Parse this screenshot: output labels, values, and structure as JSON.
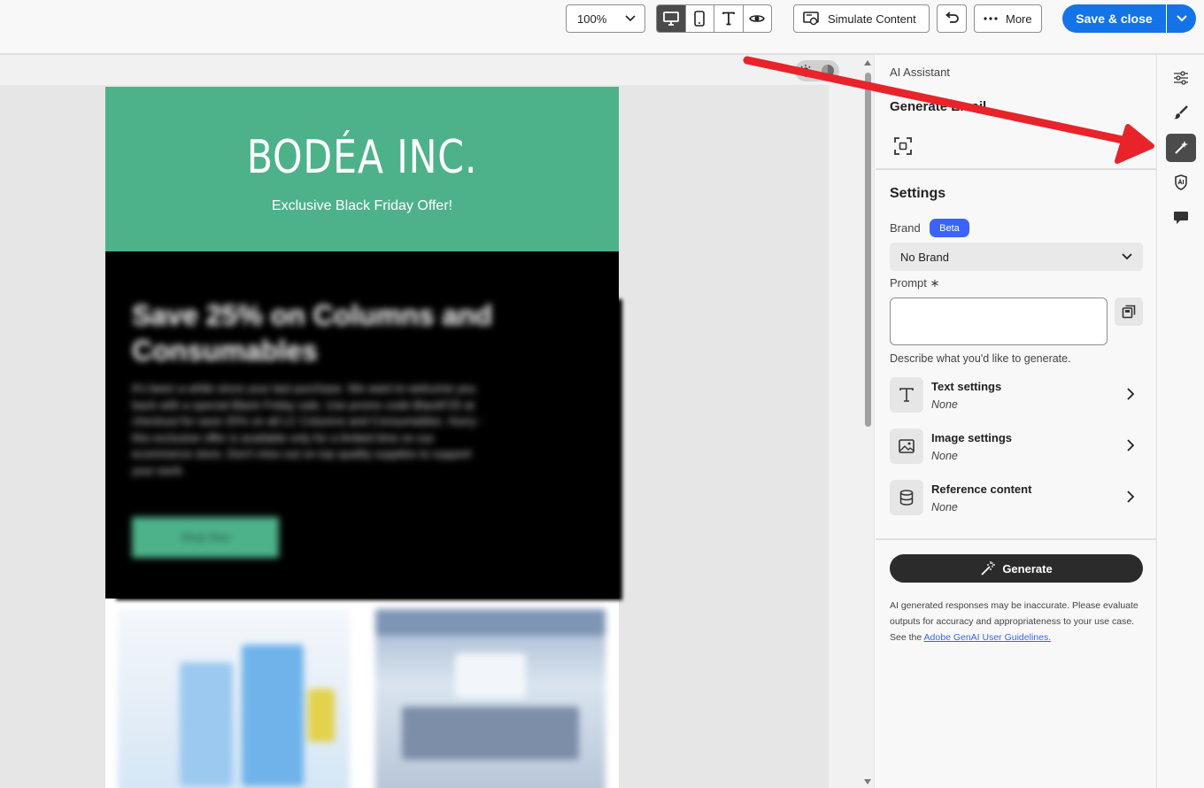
{
  "toolbar": {
    "zoom_value": "100%",
    "simulate_label": "Simulate Content",
    "more_label": "More",
    "save_label": "Save & close"
  },
  "email": {
    "logo": "BODÉA INC.",
    "tagline": "Exclusive Black Friday Offer!",
    "promo_title": "Save 25% on Columns and Consumables",
    "promo_body": "It's been a while since your last purchase. We want to welcome you back with a special Black Friday sale. Use promo code BlackF25 at checkout for save 25% on all LC Columns and Consumables. Hurry - this exclusive offer is available only for a limited time on our ecommerce store. Don't miss out on top quality supplies to support your work.",
    "promo_cta": "Shop Now"
  },
  "panel": {
    "title": "AI Assistant",
    "generate_heading": "Generate Email",
    "settings_heading": "Settings",
    "brand_label": "Brand",
    "beta_badge": "Beta",
    "brand_value": "No Brand",
    "prompt_label": "Prompt ∗",
    "prompt_value": "",
    "helper_text": "Describe what you'd like to generate.",
    "rows": [
      {
        "title": "Text settings",
        "value": "None",
        "icon": "text-icon"
      },
      {
        "title": "Image settings",
        "value": "None",
        "icon": "image-icon"
      },
      {
        "title": "Reference content",
        "value": "None",
        "icon": "database-icon"
      }
    ],
    "generate_label": "Generate",
    "disclaimer_1": "AI generated responses may be inaccurate. Please evaluate outputs for accuracy and appropriateness to your use case. See the",
    "disclaimer_link": "Adobe GenAI User Guidelines."
  },
  "rail": [
    "sliders-icon",
    "brush-icon",
    "ai-sparkle-icon",
    "shield-icon",
    "comment-icon"
  ],
  "colors": {
    "accent": "#1473e6",
    "brand_green": "#4db28a",
    "beta": "#3b63fb",
    "arrow": "#e8232a"
  }
}
